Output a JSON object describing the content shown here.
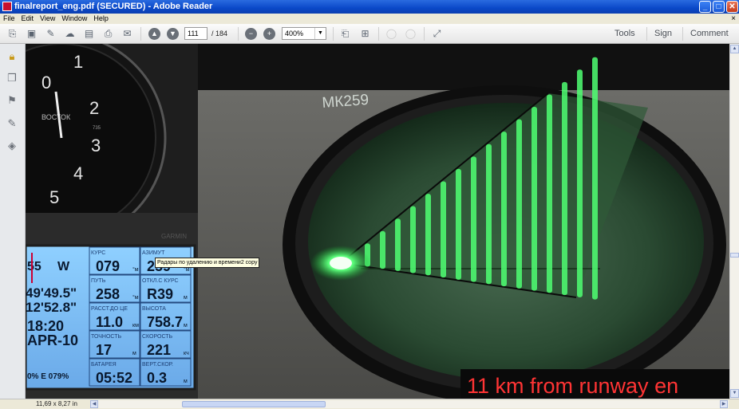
{
  "window": {
    "title": "finalreport_eng.pdf (SECURED) - Adobe Reader",
    "min_label": "_",
    "max_label": "□",
    "close_label": "✕"
  },
  "menu": {
    "items": [
      "File",
      "Edit",
      "View",
      "Window",
      "Help"
    ],
    "close": "×"
  },
  "toolbar": {
    "page_current": "111",
    "page_total": "/ 184",
    "zoom": "400%",
    "links": {
      "tools": "Tools",
      "sign": "Sign",
      "comment": "Comment"
    }
  },
  "document": {
    "tooltip": "Радары по удалению и времени2 copy",
    "dial_label": "МК259",
    "caption": "11 km from runway en",
    "clock": {
      "numbers": [
        "0",
        "1",
        "2",
        "3",
        "4",
        "5"
      ],
      "marks": [
        "735",
        "ВОСТОК"
      ]
    },
    "gps": {
      "brand": "GARMIN",
      "left": {
        "speed": "55",
        "dir": "W",
        "lat": "49'49.5\"",
        "lon": "12'52.8\"",
        "time": "18:20",
        "date": "APR-10",
        "compass": "0% E  079%"
      },
      "cells": [
        {
          "label": "КУРС",
          "value": "079",
          "unit": "°м"
        },
        {
          "label": "АЗИМУТ",
          "value": "259",
          "unit": "°м"
        },
        {
          "label": "ПУТЬ",
          "value": "258",
          "unit": "°м"
        },
        {
          "label": "ОТКЛ.С КУРС",
          "value": "R39",
          "unit": "м"
        },
        {
          "label": "РАССТ.ДО ЦЕ",
          "value": "11.0",
          "unit": "км"
        },
        {
          "label": "ВЫСОТА",
          "value": "758.7",
          "unit": "м"
        },
        {
          "label": "ТОЧНОСТЬ",
          "value": "17",
          "unit": "м"
        },
        {
          "label": "СКОРОСТЬ",
          "value": "221",
          "unit": "кч"
        },
        {
          "label": "БАТАРЕЯ",
          "value": "05:52",
          "unit": ""
        },
        {
          "label": "ВЕРТ.СКОР.",
          "value": "0.3",
          "unit": "м"
        }
      ]
    }
  },
  "status": {
    "page_size": "11,69 x 8,27 in"
  },
  "colors": {
    "titlebar": "#0a48c8",
    "screen_green": "#3cff6a",
    "caption_red": "#ff3030",
    "gps_blue": "#6ec3ff"
  }
}
